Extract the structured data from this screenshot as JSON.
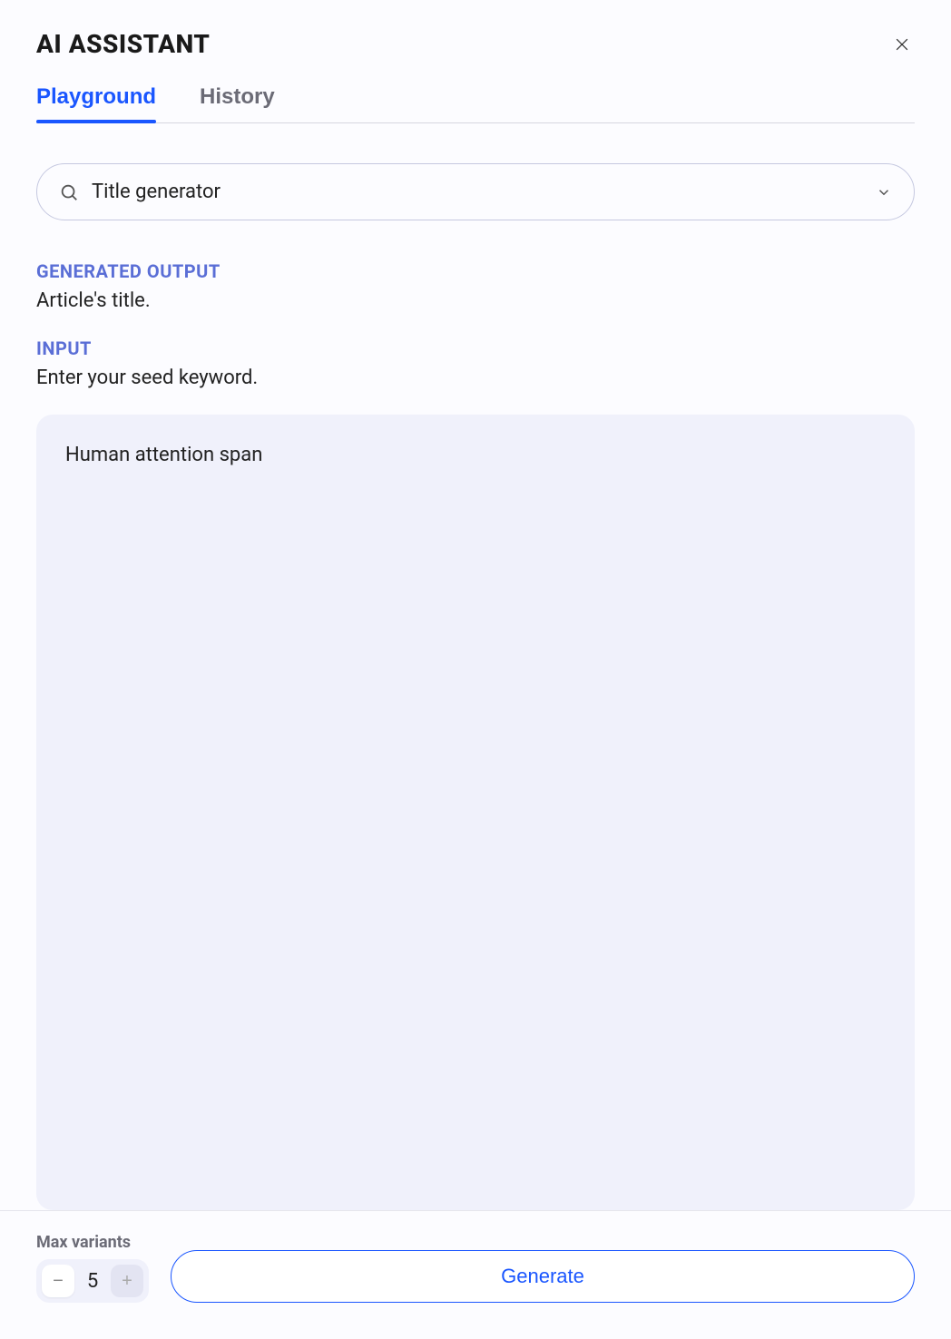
{
  "header": {
    "title": "AI ASSISTANT"
  },
  "tabs": [
    {
      "label": "Playground",
      "active": true
    },
    {
      "label": "History",
      "active": false
    }
  ],
  "selector": {
    "value": "Title generator"
  },
  "output": {
    "label": "GENERATED OUTPUT",
    "description": "Article's title."
  },
  "input": {
    "label": "INPUT",
    "description": "Enter your seed keyword.",
    "value": "Human attention span"
  },
  "footer": {
    "variants_label": "Max variants",
    "variants_value": "5",
    "generate_label": "Generate"
  }
}
